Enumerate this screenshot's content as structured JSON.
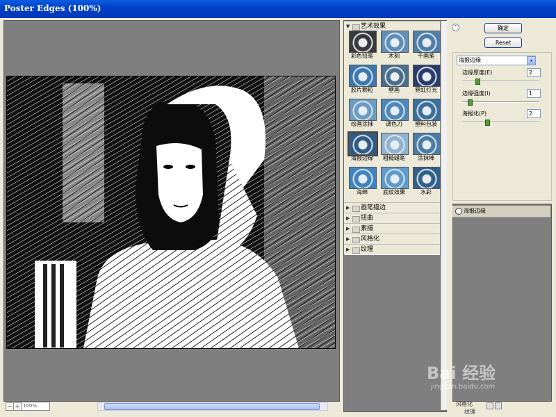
{
  "window": {
    "title": "Poster Edges (100%)"
  },
  "preview": {
    "zoom_label": "100%"
  },
  "gallery": {
    "open_category": "艺术效果",
    "thumbnails": [
      {
        "label": "彩色铅笔",
        "color": "#3a3a3a"
      },
      {
        "label": "木刻",
        "color": "#5f8fb6"
      },
      {
        "label": "干画笔",
        "color": "#4f7fa8"
      },
      {
        "label": "胶片颗粒",
        "color": "#3b78b0"
      },
      {
        "label": "壁画",
        "color": "#4a6f8c"
      },
      {
        "label": "霓虹灯光",
        "color": "#2b3c6a"
      },
      {
        "label": "绘画涂抹",
        "color": "#6b9cc4"
      },
      {
        "label": "调色刀",
        "color": "#4d88bb"
      },
      {
        "label": "塑料包装",
        "color": "#3b6f9c"
      },
      {
        "label": "海报边缘",
        "color": "#2e5c86"
      },
      {
        "label": "粗糙蜡笔",
        "color": "#8fb2cf"
      },
      {
        "label": "涂抹棒",
        "color": "#4b7ca6"
      },
      {
        "label": "海绵",
        "color": "#3f83c0"
      },
      {
        "label": "底纹效果",
        "color": "#5d9ccc"
      },
      {
        "label": "水彩",
        "color": "#31608a"
      }
    ],
    "selected": "海报边缘",
    "collapsed_categories": [
      "画笔描边",
      "扭曲",
      "素描",
      "风格化",
      "纹理"
    ]
  },
  "buttons": {
    "ok": "确定",
    "reset": "Reset",
    "collapse_glyph": "⌃"
  },
  "filter_select": {
    "value": "海报边缘",
    "arrow": "▾"
  },
  "params": [
    {
      "label": "边缘厚度(E)",
      "value": "2",
      "level": 0.2
    },
    {
      "label": "边缘强度(I)",
      "value": "1",
      "level": 0.1
    },
    {
      "label": "海报化(P)",
      "value": "2",
      "level": 0.33
    }
  ],
  "layers": {
    "items": [
      {
        "label": "海报边缘"
      }
    ],
    "bottom_labels": [
      "风格化",
      "纹理"
    ]
  },
  "watermark": {
    "text": "Bai 经验",
    "url": "jingyan.baidu.com"
  },
  "colors": {
    "title_bar": "#0042c8",
    "panel": "#ece9d8",
    "canvas": "#7f7f7f"
  }
}
